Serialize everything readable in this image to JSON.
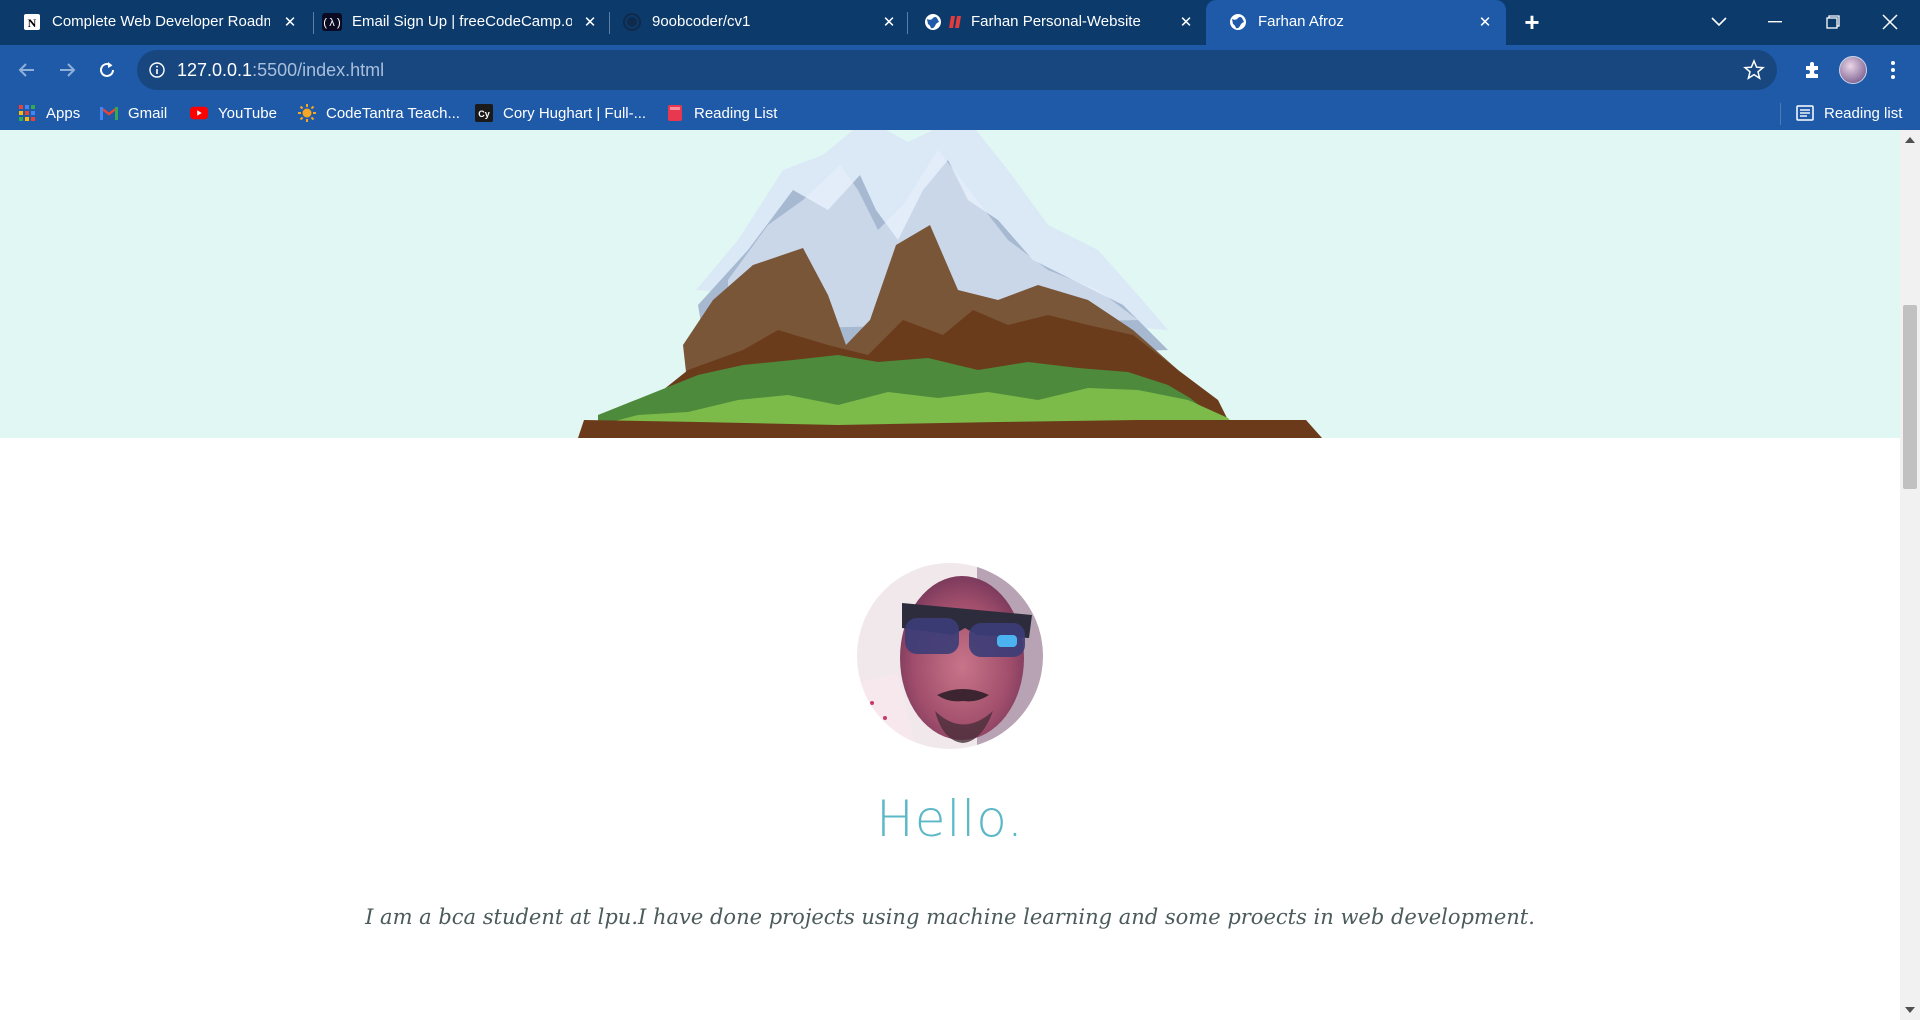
{
  "browser": {
    "tabs": [
      {
        "title": "Complete Web Developer Roadm",
        "favicon": "notion-icon"
      },
      {
        "title": "Email Sign Up | freeCodeCamp.or",
        "favicon": "freecodecamp-icon"
      },
      {
        "title": "9oobcoder/cv1",
        "favicon": "github-icon"
      },
      {
        "title": "Farhan Personal-Website",
        "favicon": "globe-icon"
      },
      {
        "title": "Farhan Afroz",
        "favicon": "globe-icon",
        "active": true
      }
    ],
    "new_tab_label": "+",
    "address": {
      "host": "127.0.0.1",
      "path": ":5500/index.html"
    },
    "bookmarks": [
      {
        "label": "Apps",
        "icon": "apps-grid-icon"
      },
      {
        "label": "Gmail",
        "icon": "gmail-icon"
      },
      {
        "label": "YouTube",
        "icon": "youtube-icon"
      },
      {
        "label": "CodeTantra Teach...",
        "icon": "codetantra-icon"
      },
      {
        "label": "Cory Hughart | Full-...",
        "icon": "cory-icon"
      },
      {
        "label": "Reading List",
        "icon": "book-icon"
      }
    ],
    "reading_list_label": "Reading list"
  },
  "page": {
    "greeting": "Hello.",
    "about": "I am a bca student at lpu.I have done projects using machine learning and some proects in web development."
  },
  "colors": {
    "tabstrip": "#0b3a6b",
    "toolbar": "#1e5aa8",
    "hero_bg": "#e1f7f3",
    "greeting": "#5cb8c6",
    "about_text": "#4b5a5a"
  }
}
